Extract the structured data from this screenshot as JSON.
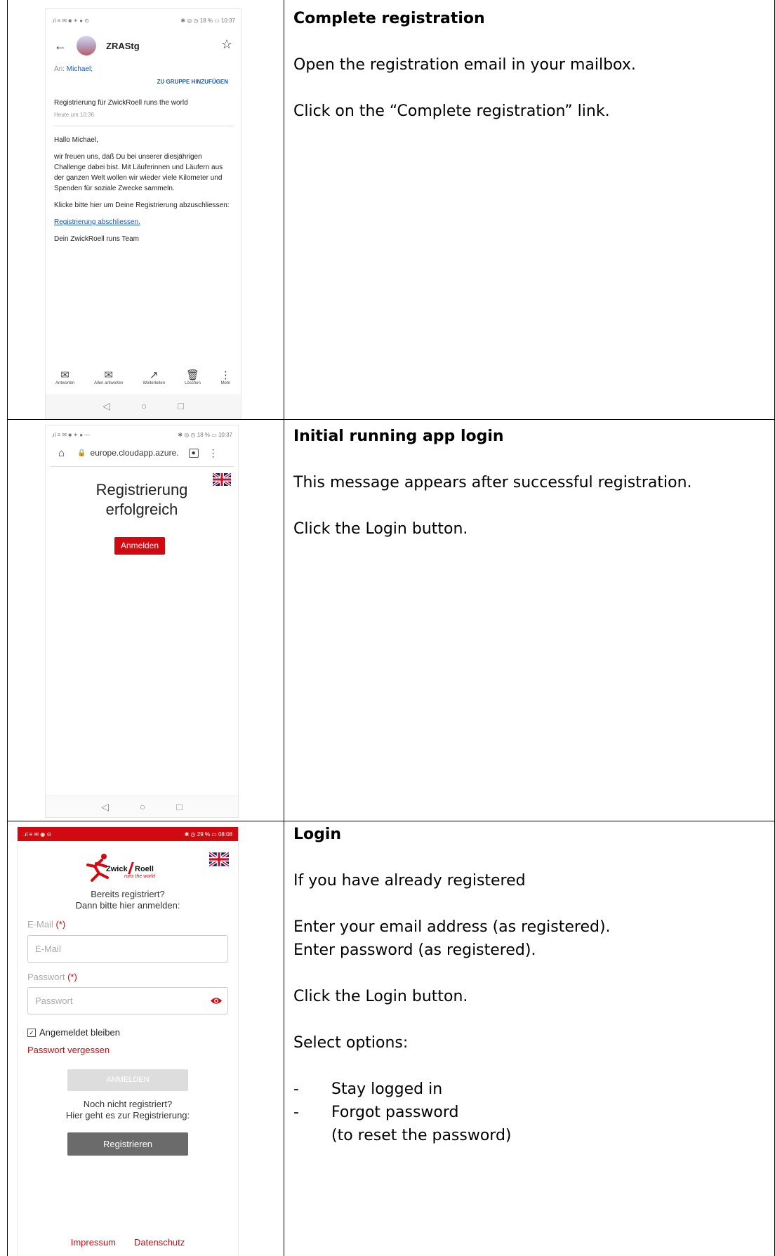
{
  "rows": [
    {
      "heading": "Complete registration",
      "lines": [
        "Open the registration email in your mailbox.",
        "Click on the “Complete registration” link."
      ]
    },
    {
      "heading": "Initial running app login",
      "lines": [
        "This message appears after successful registration.",
        "Click the Login button."
      ]
    },
    {
      "heading": "Login",
      "lines": [
        "If you have already registered",
        "Enter your email address (as registered).",
        "Enter password (as registered).",
        "Click the Login button.",
        "Select options:"
      ],
      "bullets": [
        "Stay logged in",
        "Forgot password"
      ],
      "bullet_note": "(to reset the password)"
    }
  ],
  "shot1": {
    "status_left": ".ıl ≡ ✉ ■ ✶ ● ⊙",
    "status_right": "✱ ◎ ◷ 18 % ▭ 10:37",
    "sender": "ZRAStg",
    "to_label": "An:",
    "to_name": "Michael;",
    "add_group": "ZU GRUPPE HINZUFÜGEN",
    "subject": "Registrierung für ZwickRoell runs the world",
    "date": "Heute um 10:36",
    "greeting": "Hallo Michael,",
    "body1": "wir freuen uns, daß Du bei unserer diesjährigen Challenge dabei bist. Mit Läuferinnen und Läufern aus der ganzen Welt wollen wir wieder viele Kilometer und Spenden für soziale Zwecke sammeln.",
    "body2": "Klicke bitte hier um Deine Registrierung abzuschliessen:",
    "link": "Registrierung abschliessen.",
    "signoff": "Dein ZwickRoell runs Team",
    "toolbar": [
      "Antworten",
      "Allen antworten",
      "Weiterleiten",
      "Löschen",
      "Mehr"
    ]
  },
  "shot2": {
    "status_left": ".ıl ≡ ✉ ■ ✶ ● —",
    "status_right": "✱ ◎ ◷ 18 % ▭ 10:37",
    "url": "europe.cloudapp.azure.",
    "title_line1": "Registrierung",
    "title_line2": "erfolgreich",
    "button": "Anmelden"
  },
  "shot3": {
    "status_left": ".ıl ≡ ✉ ◉ ⊙",
    "status_right": "✱ ◷ 29 % ▭ 08:08",
    "logo_word1": "Zwick",
    "logo_word2": "Roell",
    "logo_tag": "runs the world",
    "prompt1": "Bereits registriert?",
    "prompt2": "Dann bitte hier anmelden:",
    "email_label": "E-Mail",
    "required": "(*)",
    "email_placeholder": "E-Mail",
    "password_label": "Passwort",
    "password_placeholder": "Passwort",
    "stay_logged_in": "Angemeldet bleiben",
    "forgot": "Passwort vergessen",
    "login_button": "ANMELDEN",
    "register_prompt1": "Noch nicht registriert?",
    "register_prompt2": "Hier geht es zur Registrierung:",
    "register_button": "Registrieren",
    "footer_impressum": "Impressum",
    "footer_datenschutz": "Datenschutz"
  },
  "colors": {
    "brand_red": "#d10a11",
    "link_blue": "#1a56c4",
    "grey_button": "#6b6b6b"
  }
}
